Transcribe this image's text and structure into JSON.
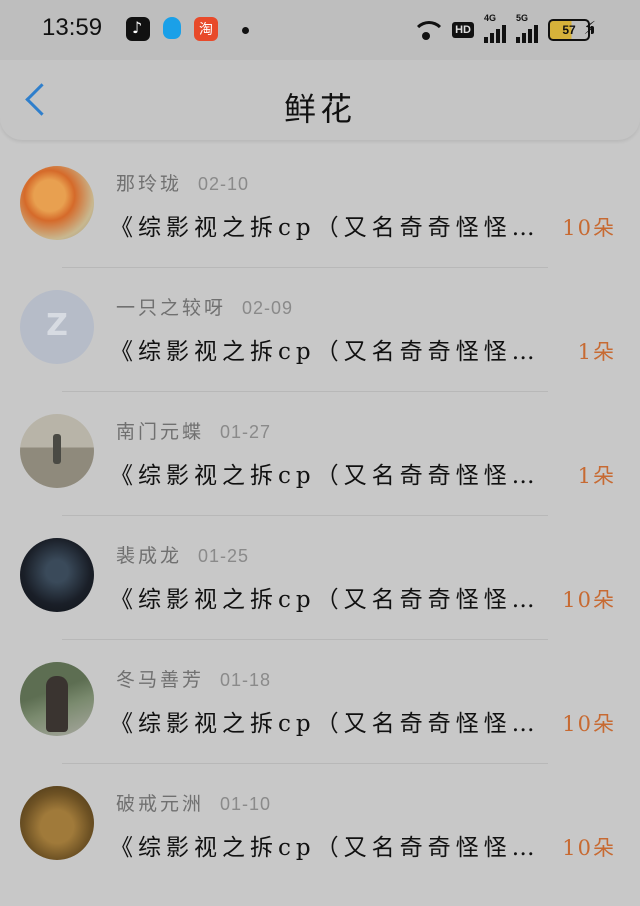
{
  "status_bar": {
    "time": "13:59",
    "hd_label": "HD",
    "network_1": "4G",
    "network_2": "5G",
    "battery": "57"
  },
  "header": {
    "title": "鲜花"
  },
  "items": [
    {
      "user": "那玲珑",
      "date": "02-10",
      "title": "《综影视之拆cp（又名奇奇怪怪的》",
      "count": "10朵"
    },
    {
      "user": "一只之较呀",
      "date": "02-09",
      "title": "《综影视之拆cp（又名奇奇怪怪的》",
      "count": "1朵"
    },
    {
      "user": "南门元蝶",
      "date": "01-27",
      "title": "《综影视之拆cp（又名奇奇怪怪的》",
      "count": "1朵"
    },
    {
      "user": "裴成龙",
      "date": "01-25",
      "title": "《综影视之拆cp（又名奇奇怪怪的》",
      "count": "10朵"
    },
    {
      "user": "冬马善芳",
      "date": "01-18",
      "title": "《综影视之拆cp（又名奇奇怪怪的》",
      "count": "10朵"
    },
    {
      "user": "破戒元洲",
      "date": "01-10",
      "title": "《综影视之拆cp（又名奇奇怪怪的》",
      "count": "10朵"
    }
  ]
}
